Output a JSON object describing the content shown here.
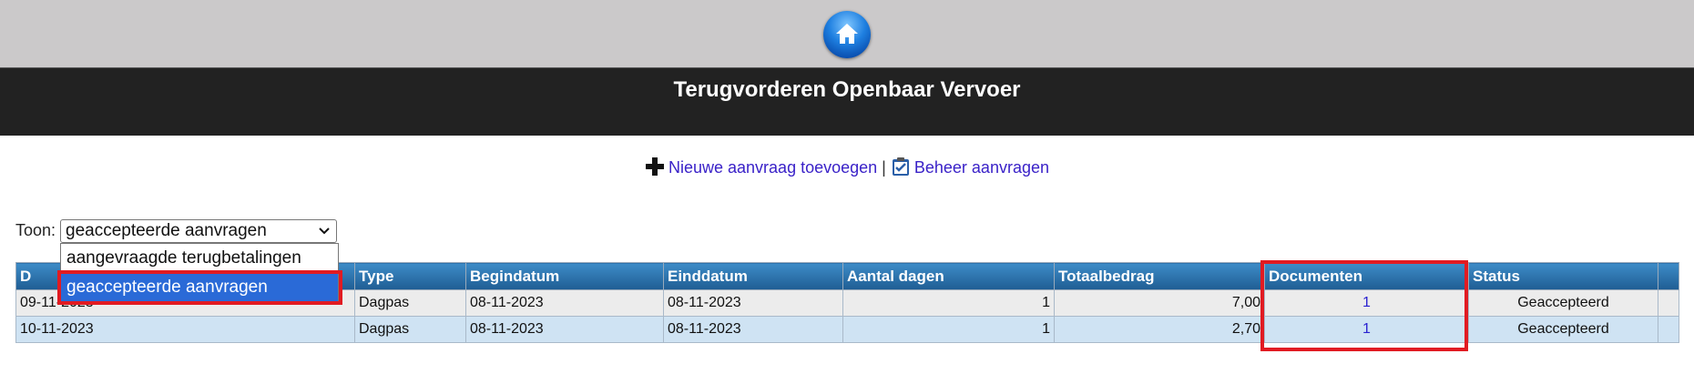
{
  "header": {
    "home_icon": "home-icon",
    "title": "Terugvorderen Openbaar Vervoer"
  },
  "actions": {
    "add_icon": "plus-icon",
    "add_label": "Nieuwe aanvraag toevoegen",
    "separator": "|",
    "manage_icon": "checklist-icon",
    "manage_label": "Beheer aanvragen"
  },
  "filter": {
    "label": "Toon:",
    "selected": "geaccepteerde aanvragen",
    "options": [
      "aangevraagde terugbetalingen",
      "geaccepteerde aanvragen"
    ]
  },
  "table": {
    "columns": [
      "D",
      "Type",
      "Begindatum",
      "Einddatum",
      "Aantal dagen",
      "Totaalbedrag",
      "Documenten",
      "Status"
    ],
    "rows": [
      {
        "date": "09-11-2023",
        "type": "Dagpas",
        "begin": "08-11-2023",
        "end": "08-11-2023",
        "days": "1",
        "total": "7,00",
        "docs": "1",
        "status": "Geaccepteerd"
      },
      {
        "date": "10-11-2023",
        "type": "Dagpas",
        "begin": "08-11-2023",
        "end": "08-11-2023",
        "days": "1",
        "total": "2,70",
        "docs": "1",
        "status": "Geaccepteerd"
      }
    ]
  },
  "colors": {
    "highlight": "#e11b22",
    "header_bar": "#222222",
    "link": "#3a22c8"
  }
}
